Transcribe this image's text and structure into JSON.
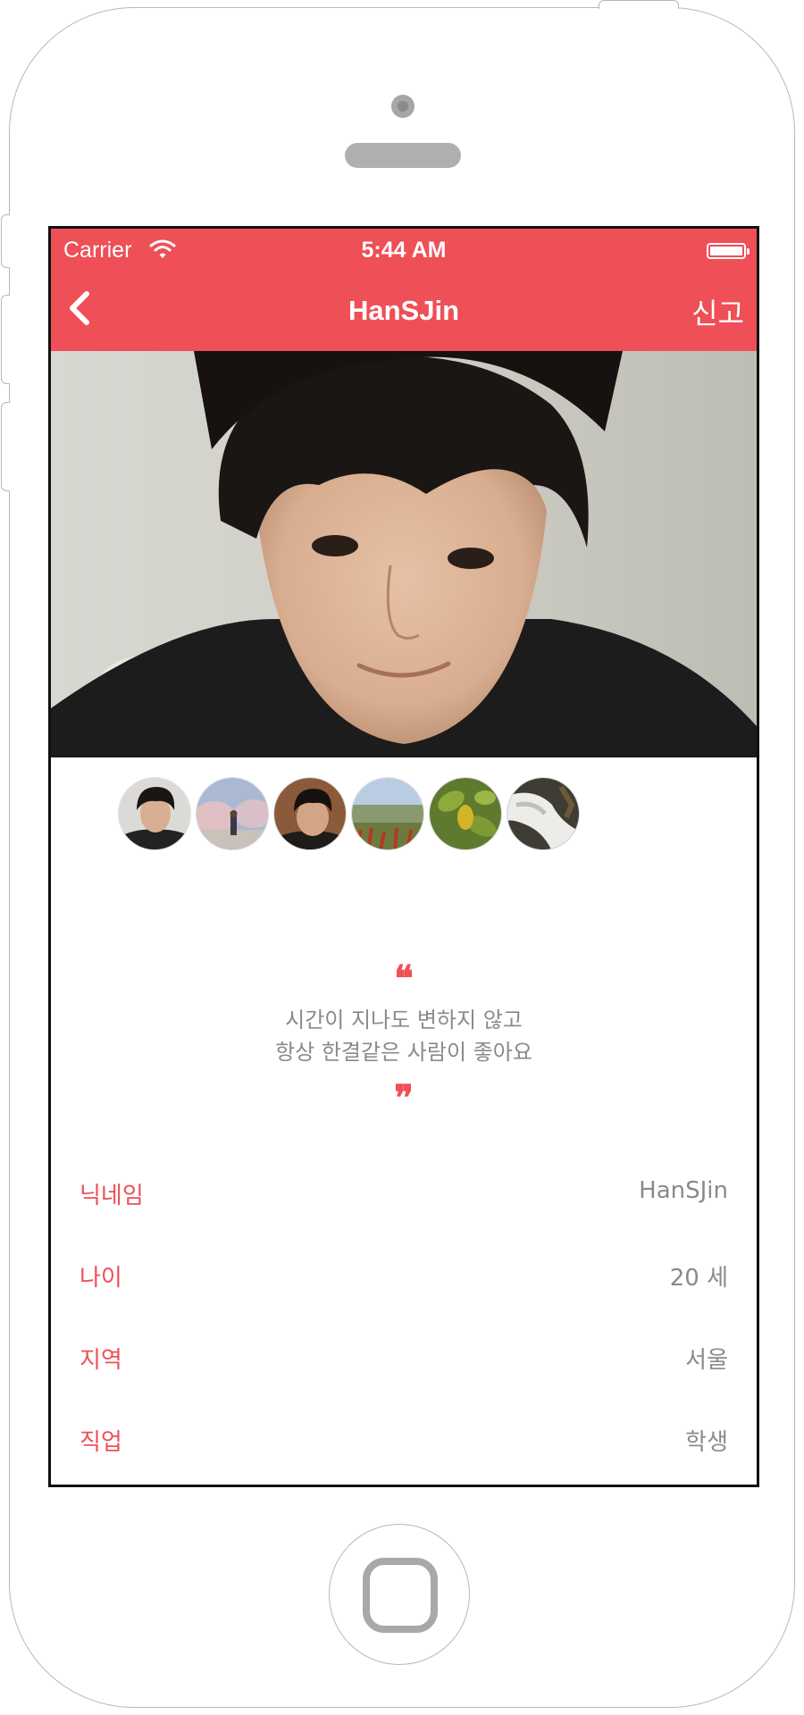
{
  "status_bar": {
    "carrier": "Carrier",
    "time": "5:44 AM"
  },
  "nav": {
    "title": "HanSJin",
    "report_label": "신고"
  },
  "thumbnails": [
    "thumb-1",
    "thumb-2",
    "thumb-3",
    "thumb-4",
    "thumb-5",
    "thumb-6"
  ],
  "bio": {
    "open_mark": "❝",
    "line1": "시간이 지나도 변하지 않고",
    "line2": "항상 한결같은 사람이 좋아요",
    "close_mark": "❞"
  },
  "profile": {
    "nickname": {
      "label": "닉네임",
      "value": "HanSJin"
    },
    "age": {
      "label": "나이",
      "value": "20 세"
    },
    "region": {
      "label": "지역",
      "value": "서울"
    },
    "job": {
      "label": "직업",
      "value": "학생"
    }
  },
  "colors": {
    "accent": "#ef4f57",
    "text_muted": "#8a8a8a"
  }
}
